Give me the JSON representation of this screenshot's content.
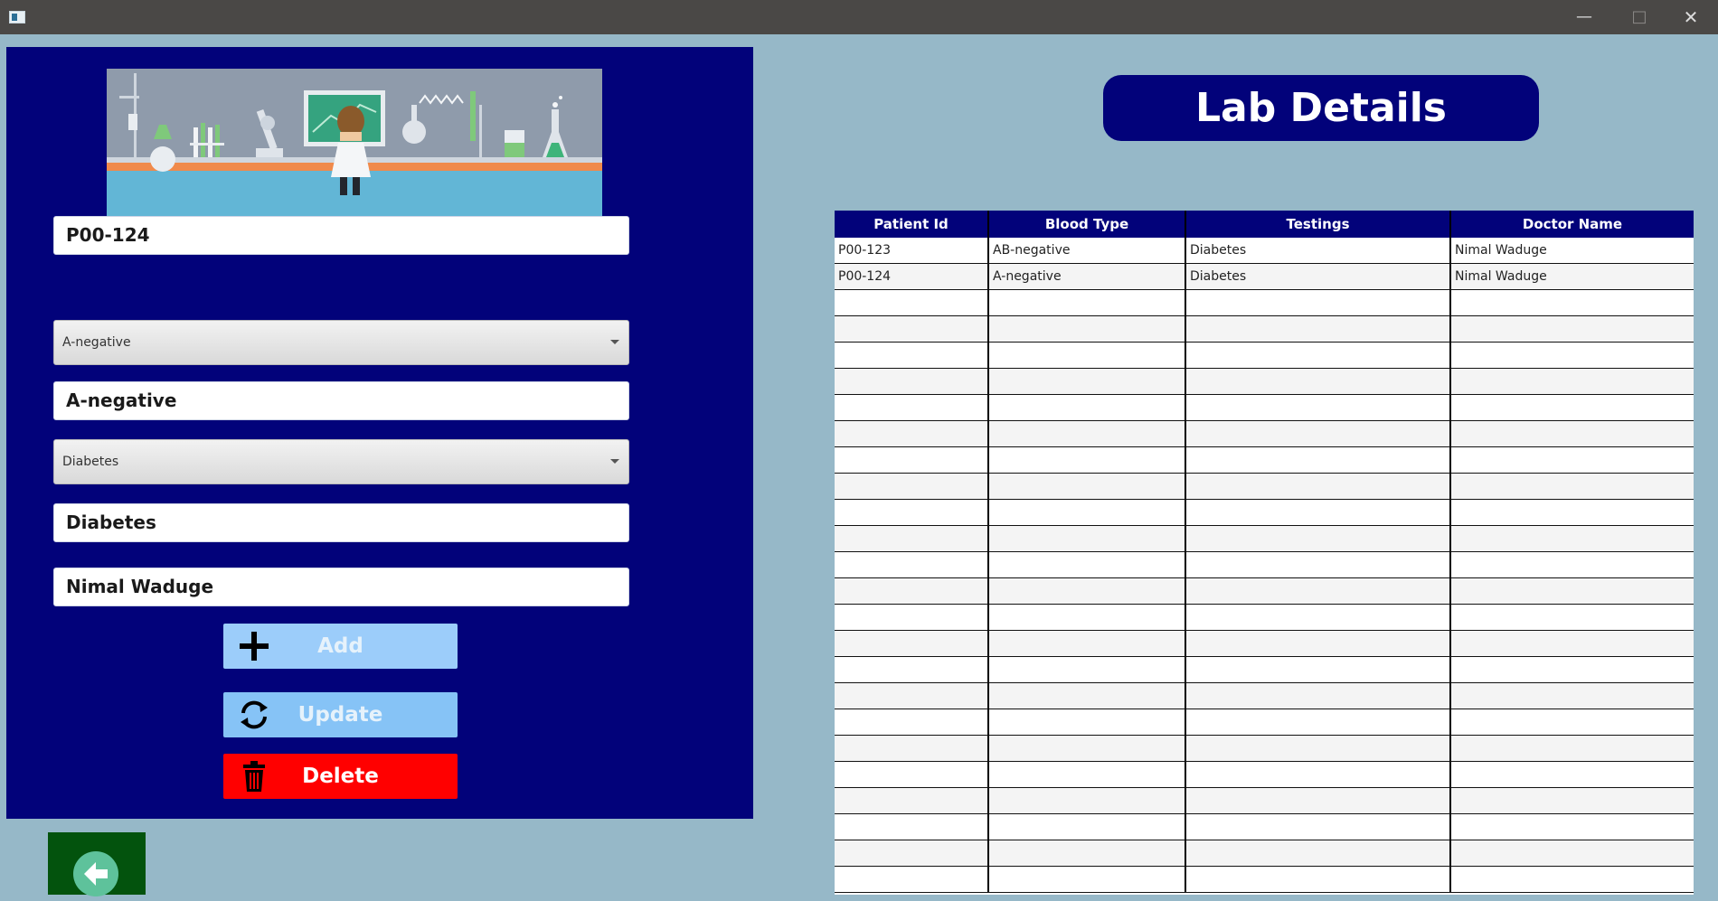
{
  "window": {
    "controls": {
      "minimize": "—",
      "maximize": "□",
      "close": "✕"
    }
  },
  "form": {
    "patient_id": "P00-124",
    "blood_type_select": "A-negative",
    "blood_type_value": "A-negative",
    "testing_select": "Diabetes",
    "testing_value": "Diabetes",
    "doctor_name": "Nimal Waduge",
    "buttons": {
      "add": "Add",
      "update": "Update",
      "delete": "Delete"
    }
  },
  "header": {
    "title": "Lab Details"
  },
  "table": {
    "columns": [
      "Patient Id",
      "Blood Type",
      "Testings",
      "Doctor Name"
    ],
    "rows": [
      [
        "P00-123",
        "AB-negative",
        "Diabetes",
        "Nimal Waduge"
      ],
      [
        "P00-124",
        "A-negative",
        "Diabetes",
        "Nimal Waduge"
      ]
    ]
  },
  "colors": {
    "panel": "#02027a",
    "background": "#96b8c8",
    "add_button": "#9ccdfa",
    "update_button": "#86c3f6",
    "delete_button": "#ff0000",
    "back_button": "#03530d"
  },
  "icons": {
    "add": "plus-icon",
    "update": "refresh-icon",
    "delete": "trash-icon",
    "back": "arrow-left-icon"
  }
}
